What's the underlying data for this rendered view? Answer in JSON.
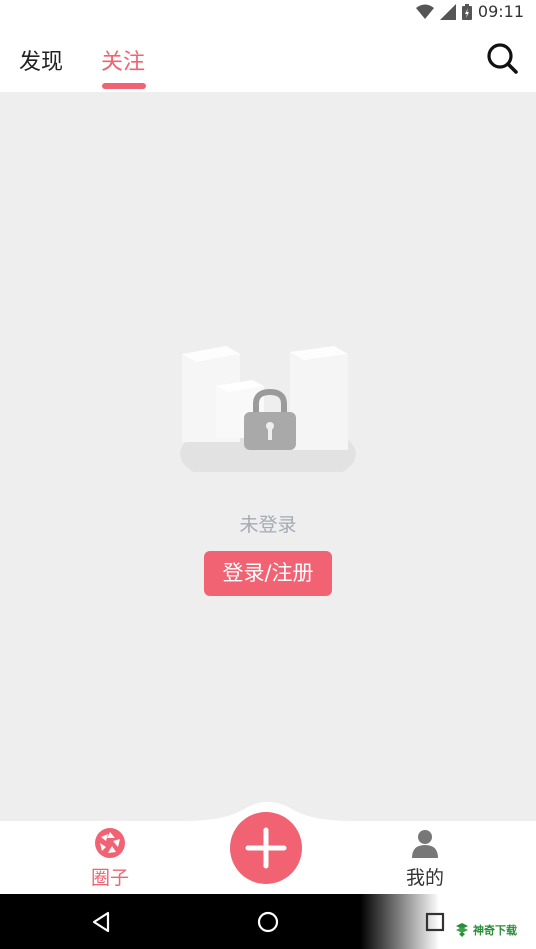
{
  "status_bar": {
    "time": "09:11"
  },
  "top_nav": {
    "tabs": [
      {
        "label": "发现",
        "active": false
      },
      {
        "label": "关注",
        "active": true
      }
    ],
    "search_icon": "search-icon"
  },
  "empty_state": {
    "illustration": "locked-city-illustration",
    "message": "未登录",
    "login_button": "登录/注册"
  },
  "bottom_tabs": {
    "circle_label": "圈子",
    "mine_label": "我的",
    "circle_icon": "aperture-icon",
    "mine_icon": "person-icon",
    "center_button_icon": "plus-icon"
  },
  "watermark": {
    "text": "神奇下载"
  },
  "colors": {
    "accent": "#f16273",
    "content_bg": "#eeeeee",
    "muted_text": "#a3abb3"
  }
}
